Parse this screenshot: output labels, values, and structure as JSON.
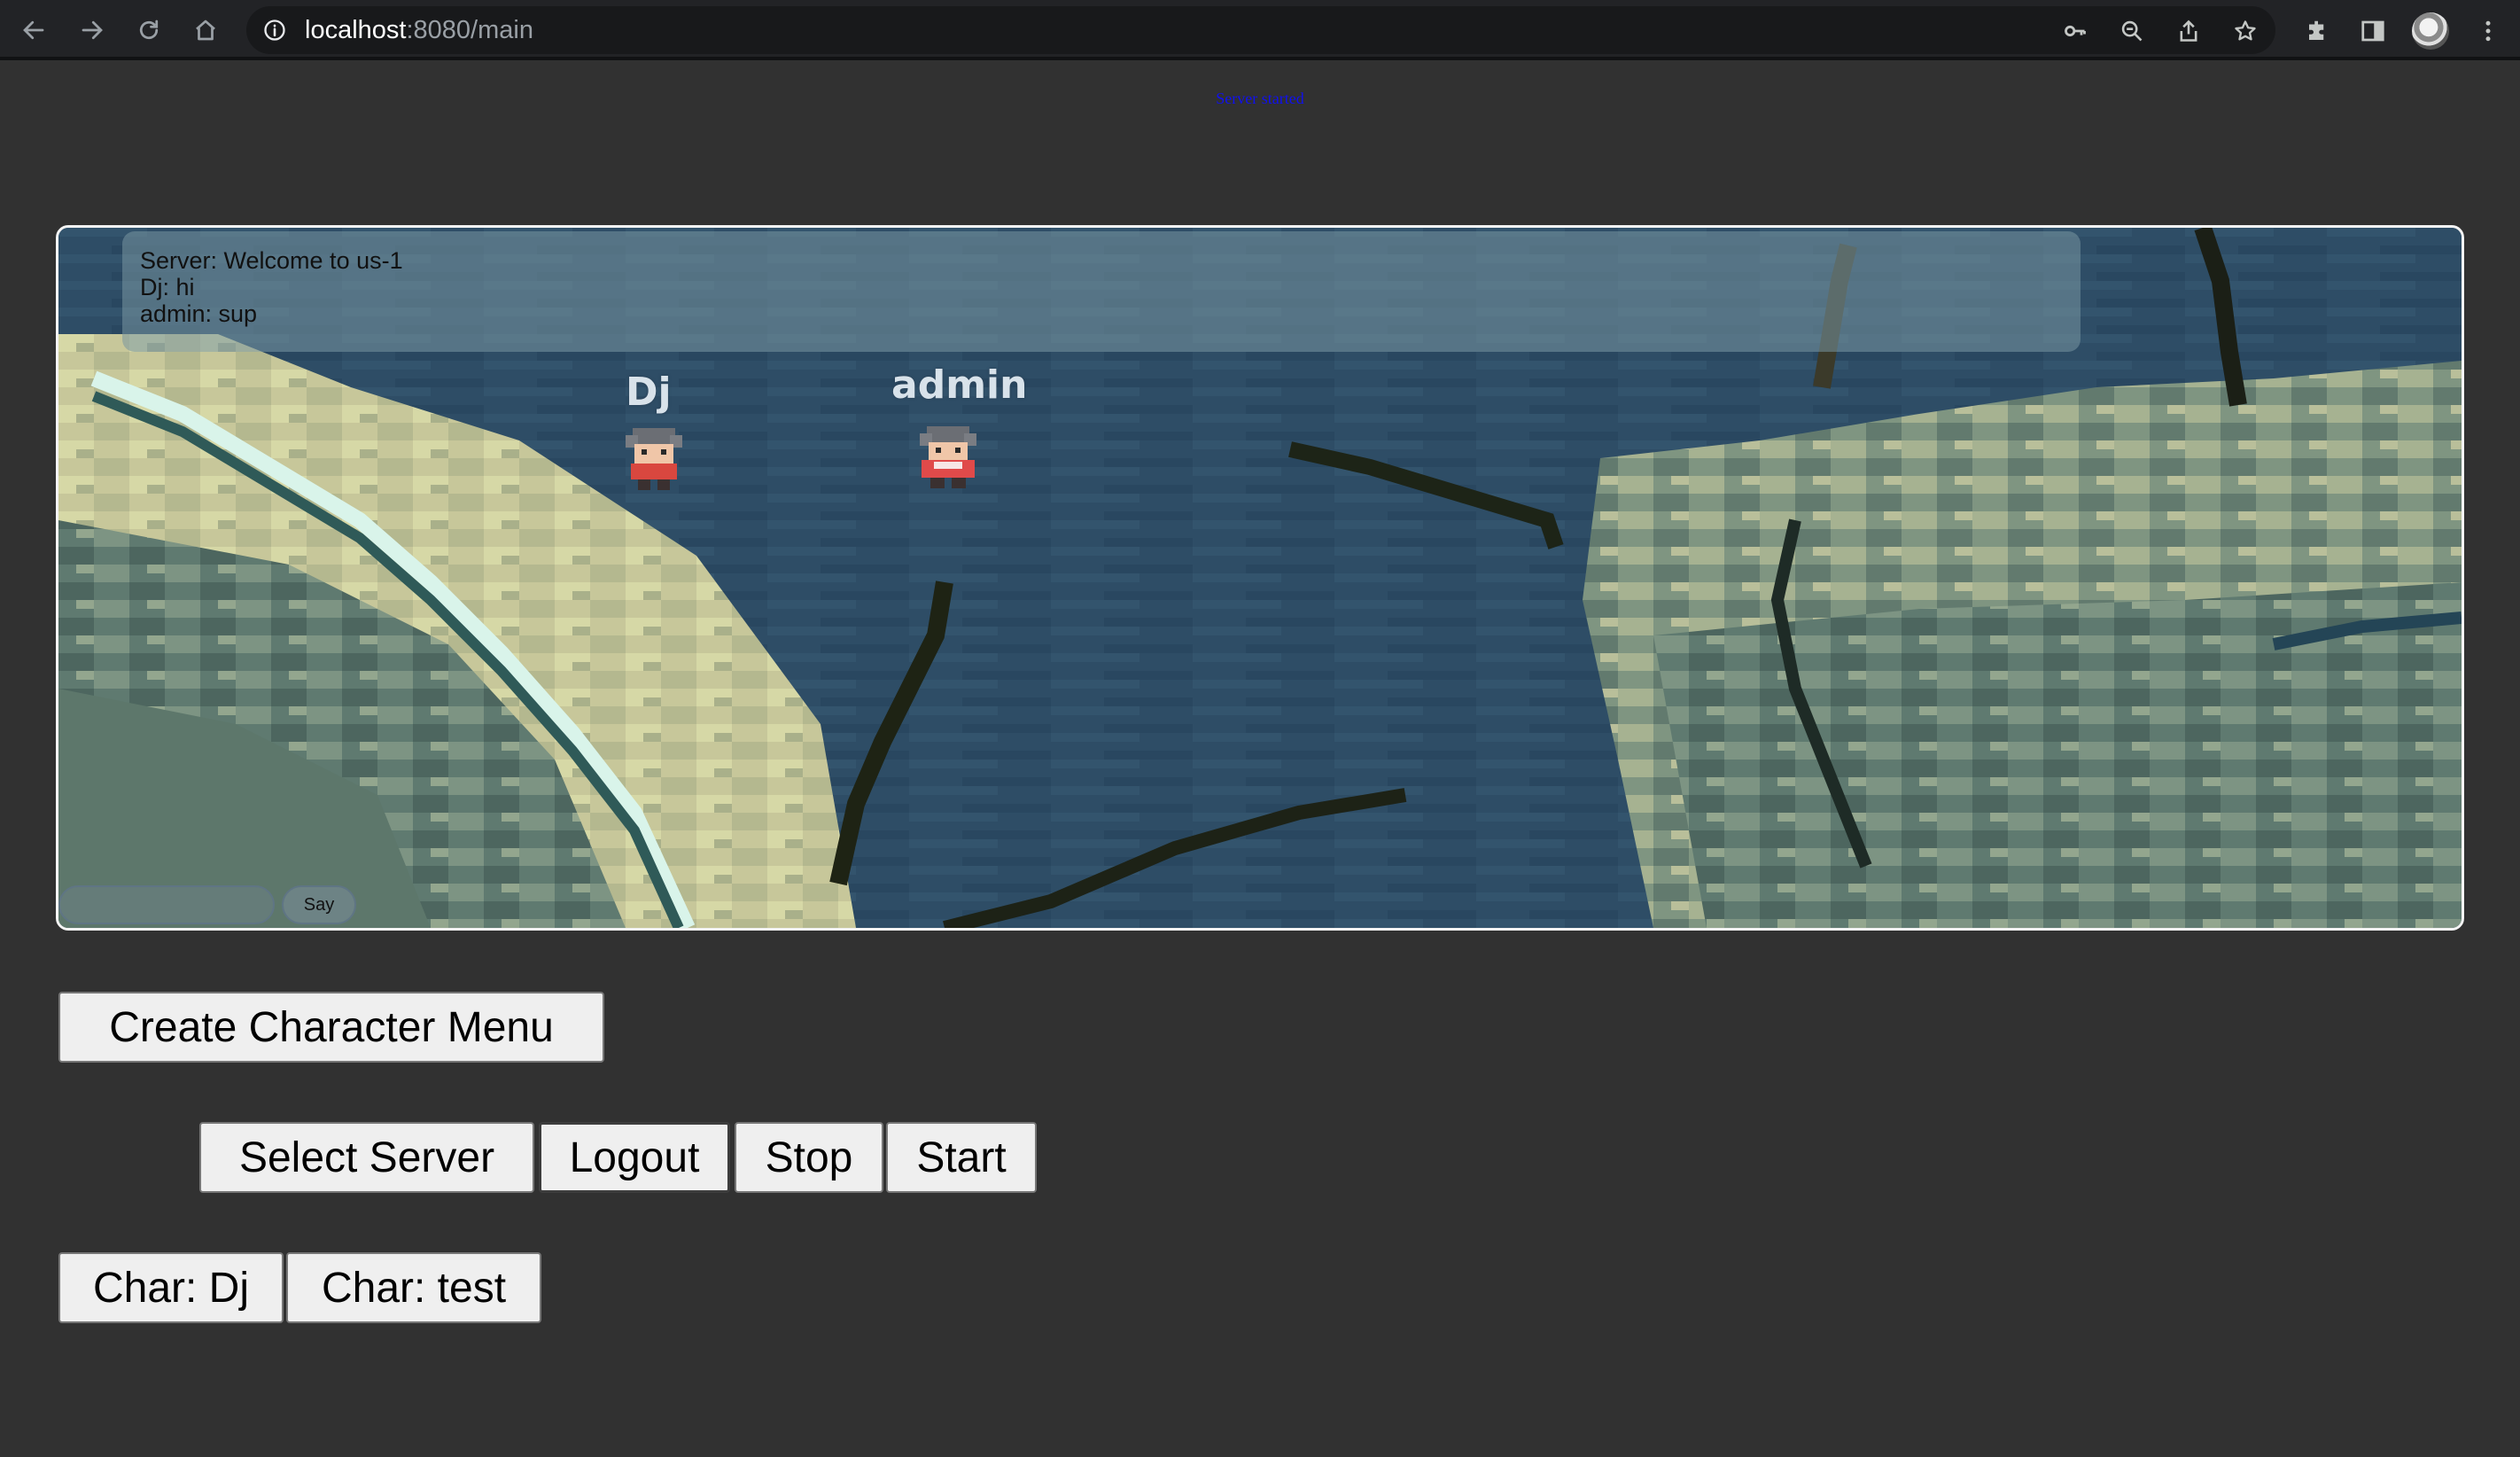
{
  "browser": {
    "url_host": "localhost",
    "url_rest": ":8080/main",
    "icons": [
      "back-arrow-icon",
      "forward-arrow-icon",
      "reload-icon",
      "home-icon",
      "info-icon",
      "key-icon",
      "zoom-icon",
      "share-icon",
      "star-icon",
      "extensions-icon",
      "side-panel-icon",
      "profile-avatar",
      "menu-icon"
    ]
  },
  "status_message": "Server started",
  "status_color": "#1010ee",
  "game": {
    "chat_lines": [
      "Server: Welcome to us-1",
      "Dj: hi",
      "admin: sup"
    ],
    "chat_input_placeholder": "",
    "say_label": "Say",
    "players": [
      {
        "name": "Dj"
      },
      {
        "name": "admin"
      }
    ]
  },
  "buttons": {
    "create_character_menu": "Create Character Menu",
    "select_server": "Select Server",
    "logout": "Logout",
    "stop": "Stop",
    "start": "Start",
    "char_dj": "Char: Dj",
    "char_test": "Char: test"
  }
}
